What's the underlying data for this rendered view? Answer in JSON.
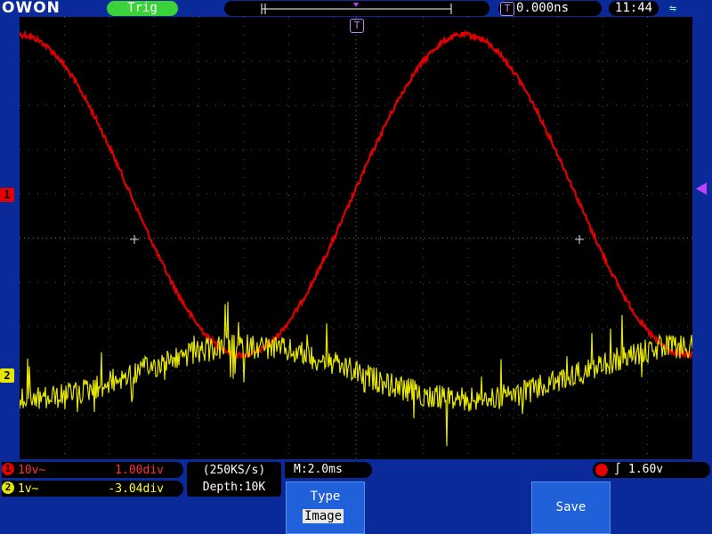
{
  "header": {
    "brand": "OWON",
    "trigger_status": "Trig",
    "trigger_badge": "T",
    "time_offset": "0.000ns",
    "clock": "11:44"
  },
  "channels": [
    {
      "badge": "1",
      "scale": "10v~",
      "offset": "1.00div",
      "color": "#e60000"
    },
    {
      "badge": "2",
      "scale": "1v~",
      "offset": "-3.04div",
      "color": "#e6e600"
    }
  ],
  "acquisition": {
    "sample_rate": "(250KS/s)",
    "depth": "Depth:10K",
    "timebase": "M:2.0ms"
  },
  "trigger": {
    "edge": "∫",
    "level": "1.60v"
  },
  "menu": {
    "type_label": "Type",
    "type_value": "Image",
    "save_label": "Save"
  },
  "colors": {
    "ch1": "#e60000",
    "ch2": "#e6e600",
    "background": "#0a2a9a",
    "trig_marker": "#c040ff"
  }
}
